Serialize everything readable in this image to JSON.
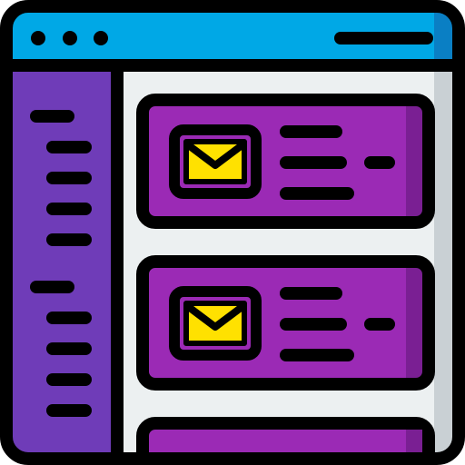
{
  "illustration": {
    "type": "flat-icon",
    "subject": "email-inbox-app-window",
    "colors": {
      "outline": "#000000",
      "titlebar": "#00A8E6",
      "titlebar_shade": "#0A7FC4",
      "sidebar": "#6F3CB8",
      "content_bg": "#ECF0F1",
      "content_shade": "#C9D0D4",
      "card": "#9B2AB5",
      "card_shade": "#7A1F93",
      "envelope": "#FFE100",
      "envelope_box": "#9B2AB5"
    },
    "titlebar": {
      "window_dots": [
        "dot",
        "dot",
        "dot"
      ],
      "address_bar_icon": "line-icon"
    },
    "sidebar": {
      "lines": [
        "line",
        "line",
        "line",
        "line",
        "line",
        "line",
        "line",
        "line",
        "line",
        "line"
      ]
    },
    "cards": [
      {
        "icon": "envelope-icon",
        "text_lines": [
          "line",
          "line",
          "line"
        ],
        "badge": "dash-icon"
      },
      {
        "icon": "envelope-icon",
        "text_lines": [
          "line",
          "line",
          "line"
        ],
        "badge": "dash-icon"
      },
      {
        "icon": "none",
        "text_lines": [],
        "badge": "none"
      }
    ]
  }
}
